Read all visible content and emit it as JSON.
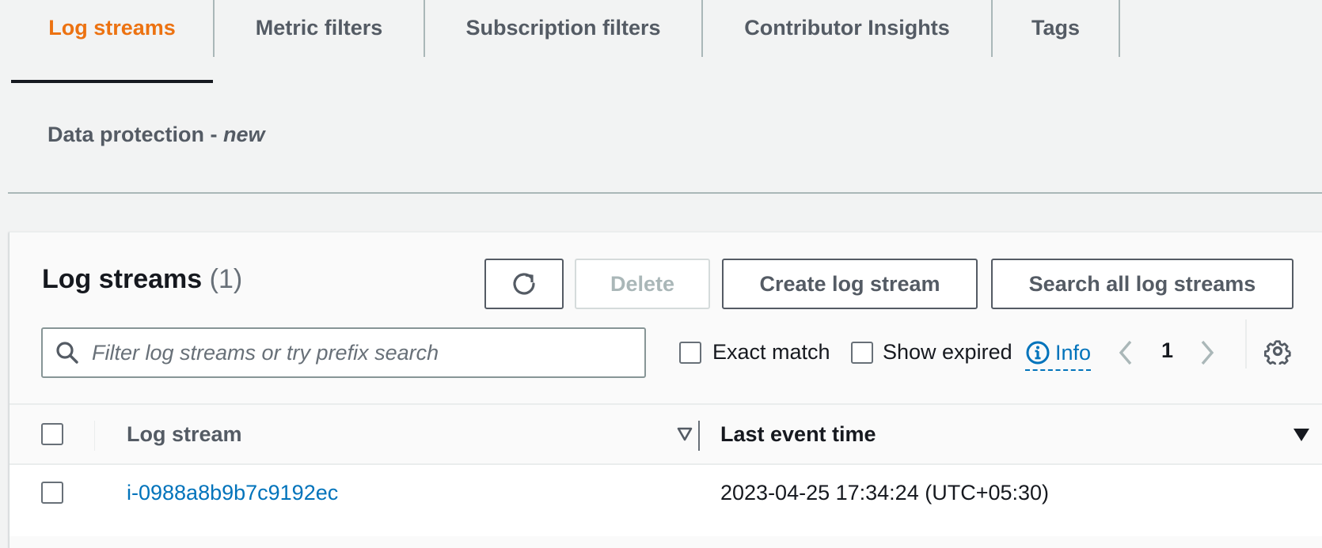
{
  "tabs": {
    "items": [
      {
        "label": "Log streams",
        "active": true
      },
      {
        "label": "Metric filters",
        "active": false
      },
      {
        "label": "Subscription filters",
        "active": false
      },
      {
        "label": "Contributor Insights",
        "active": false
      },
      {
        "label": "Tags",
        "active": false
      }
    ],
    "second_row": {
      "label": "Data protection - ",
      "badge": "new"
    },
    "active_color": "#ec7211"
  },
  "panel": {
    "title": "Log streams",
    "count": "(1)",
    "buttons": {
      "refresh_icon": "refresh-icon",
      "delete_label": "Delete",
      "create_label": "Create log stream",
      "search_label": "Search all log streams"
    },
    "filter": {
      "placeholder": "Filter log streams or try prefix search",
      "value": "",
      "icon": "search-icon"
    },
    "exact_match": {
      "label": "Exact match",
      "checked": false
    },
    "show_expired": {
      "label": "Show expired",
      "checked": false
    },
    "info": {
      "label": "Info",
      "icon": "info-icon"
    },
    "pagination": {
      "current_page": "1",
      "prev_icon": "chevron-left-icon",
      "next_icon": "chevron-right-icon"
    },
    "settings_icon": "gear-icon"
  },
  "table": {
    "columns": [
      {
        "label": "Log stream",
        "sort": "none"
      },
      {
        "label": "Last event time",
        "sort": "descending"
      }
    ],
    "rows": [
      {
        "log_stream": "i-0988a8b9b7c9192ec",
        "last_event_time": "2023-04-25 17:34:24 (UTC+05:30)",
        "selected": false
      }
    ]
  },
  "colors": {
    "link": "#0073bb",
    "text": "#16191f",
    "muted": "#545b64",
    "disabled": "#aab7b8"
  }
}
